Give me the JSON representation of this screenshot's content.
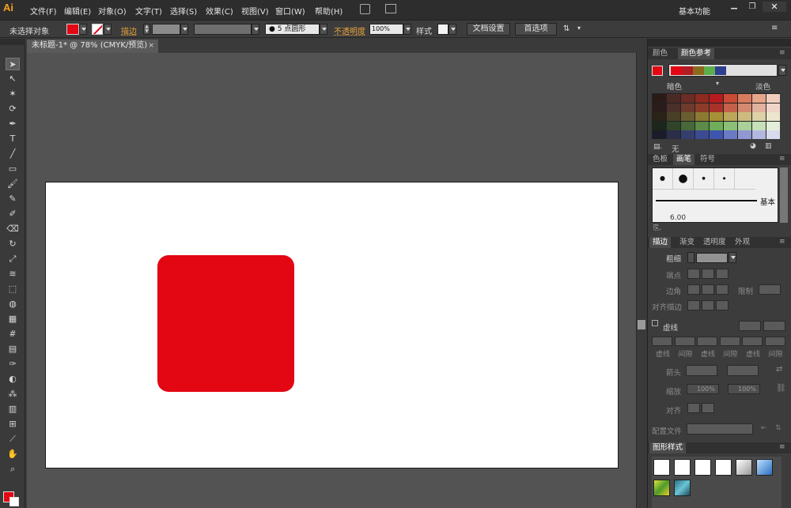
{
  "app": {
    "logo": "Ai",
    "workspace": "基本功能"
  },
  "menu": [
    "文件(F)",
    "编辑(E)",
    "对象(O)",
    "文字(T)",
    "选择(S)",
    "效果(C)",
    "视图(V)",
    "窗口(W)",
    "帮助(H)"
  ],
  "options": {
    "selection": "未选择对象",
    "stroke_label": "描边",
    "brush_value": "5",
    "brush_shape": "点圆形",
    "opacity_label": "不透明度",
    "opacity_value": "100%",
    "style_label": "样式",
    "doc_setup": "文档设置",
    "preferences": "首选项"
  },
  "document": {
    "tab_title": "未标题-1* @ 78% (CMYK/预览)"
  },
  "colors": {
    "fill": "#e30613",
    "artboard": "#ffffff",
    "canvas": "#535353"
  },
  "color_panel": {
    "tab_color": "颜色",
    "tab_guide": "颜色参考",
    "dark_label": "暗色",
    "light_label": "淡色",
    "none_label": "无",
    "harmony": [
      "#e30613",
      "#b01c24",
      "#8b6a1d",
      "#5fae4d",
      "#2f3f8f"
    ],
    "rows": [
      [
        "#2a1a18",
        "#4a2a24",
        "#6a2c24",
        "#8e2a20",
        "#b51b1e",
        "#c94b35",
        "#d77b5c",
        "#e6a68a",
        "#f0cdbc"
      ],
      [
        "#2a1c1a",
        "#4a302a",
        "#6e3a2c",
        "#8e3c2a",
        "#a8322a",
        "#c4614b",
        "#d48a70",
        "#e2b29e",
        "#eed5c8"
      ],
      [
        "#2a2418",
        "#484026",
        "#6a5e30",
        "#8c7a32",
        "#a69038",
        "#bca65a",
        "#ccbc80",
        "#dcd2a8",
        "#ece6cc"
      ],
      [
        "#1c261a",
        "#30442a",
        "#46683a",
        "#5c8a48",
        "#6eae58",
        "#8cc078",
        "#a8d098",
        "#c6e0b8",
        "#e2eed8"
      ],
      [
        "#1a1c2a",
        "#2a2e48",
        "#363e6e",
        "#3c4a92",
        "#3e56b0",
        "#6a7ac4",
        "#9098d2",
        "#b4b8e0",
        "#d8daee"
      ]
    ]
  },
  "brush_panel": {
    "tab_swatches": "色板",
    "tab_brushes": "画笔",
    "tab_symbols": "符号",
    "basic_label": "基本",
    "size_value": "6.00"
  },
  "stroke_panel": {
    "tab_stroke": "描边",
    "tab_gradient": "渐变",
    "tab_transparency": "透明度",
    "tab_appearance": "外观",
    "weight": "粗细",
    "cap": "端点",
    "corner": "边角",
    "limit": "限制",
    "align": "对齐描边",
    "dashed": "虚线",
    "dash_labels": [
      "虚线",
      "间隙",
      "虚线",
      "间隙",
      "虚线",
      "间隙"
    ],
    "arrows": "箭头",
    "scale": "缩放",
    "scale1": "100%",
    "scale2": "100%",
    "align2": "对齐",
    "profile": "配置文件"
  },
  "graphic_styles": {
    "title": "图形样式"
  }
}
